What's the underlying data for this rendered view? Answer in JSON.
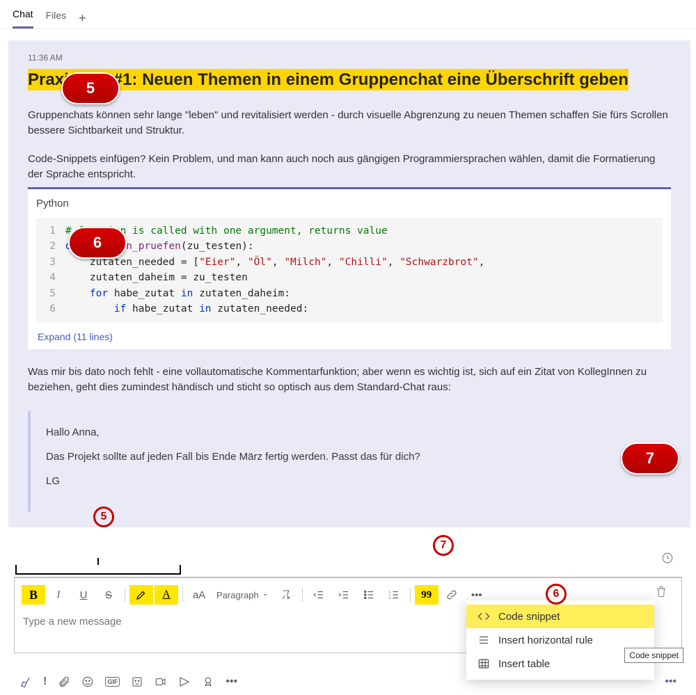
{
  "tabs": {
    "chat": "Chat",
    "files": "Files"
  },
  "message": {
    "time": "11:36 AM",
    "heading": "Praxistipp #1: Neuen Themen in einem Gruppenchat eine Überschrift geben",
    "p1": "Gruppenchats können sehr lange \"leben\" und revitalisiert werden - durch visuelle Abgrenzung zu neuen Themen schaffen Sie fürs Scrollen bessere Sichtbarkeit und Struktur.",
    "p2": "Code-Snippets einfügen? Kein Problem, und man kann auch noch aus gängigen Programmiersprachen wählen, damit die Formatierung der Sprache entspricht.",
    "p3": "Was mir bis dato noch fehlt - eine vollautomatische Kommentarfunktion; aber wenn es wichtig ist, sich auf ein Zitat von KollegInnen zu beziehen, geht dies zumindest händisch und sticht so optisch aus dem Standard-Chat raus:"
  },
  "code": {
    "language": "Python",
    "lines": [
      {
        "n": "1",
        "parts": [
          {
            "t": "spc",
            "v": ""
          },
          {
            "t": "com",
            "v": "# function is called with one argument, returns value"
          }
        ]
      },
      {
        "n": "2",
        "parts": [
          {
            "t": "kw",
            "v": "def "
          },
          {
            "t": "fn",
            "v": "zutaten_pruefen"
          },
          {
            "t": "",
            "v": "(zu_testen):"
          }
        ]
      },
      {
        "n": "3",
        "parts": [
          {
            "t": "",
            "v": "    zutaten_needed = ["
          },
          {
            "t": "str",
            "v": "\"Eier\""
          },
          {
            "t": "",
            "v": ", "
          },
          {
            "t": "str",
            "v": "\"Öl\""
          },
          {
            "t": "",
            "v": ", "
          },
          {
            "t": "str",
            "v": "\"Milch\""
          },
          {
            "t": "",
            "v": ", "
          },
          {
            "t": "str",
            "v": "\"Chilli\""
          },
          {
            "t": "",
            "v": ", "
          },
          {
            "t": "str",
            "v": "\"Schwarzbrot\""
          },
          {
            "t": "",
            "v": ","
          }
        ]
      },
      {
        "n": "4",
        "parts": [
          {
            "t": "",
            "v": "    zutaten_daheim = zu_testen"
          }
        ]
      },
      {
        "n": "5",
        "parts": [
          {
            "t": "",
            "v": "    "
          },
          {
            "t": "kw",
            "v": "for"
          },
          {
            "t": "",
            "v": " habe_zutat "
          },
          {
            "t": "kw",
            "v": "in"
          },
          {
            "t": "",
            "v": " zutaten_daheim:"
          }
        ]
      },
      {
        "n": "6",
        "parts": [
          {
            "t": "",
            "v": "        "
          },
          {
            "t": "kw",
            "v": "if"
          },
          {
            "t": "",
            "v": " habe_zutat "
          },
          {
            "t": "kw",
            "v": "in"
          },
          {
            "t": "",
            "v": " zutaten_needed:"
          }
        ]
      }
    ],
    "expand": "Expand (11 lines)"
  },
  "quote": {
    "greet": "Hallo Anna,",
    "body": "Das Projekt sollte auf jeden Fall bis Ende März fertig werden. Passt das für dich?",
    "sig": "LG"
  },
  "toolbar": {
    "bold": "B",
    "italic": "I",
    "underline": "U",
    "strike": "S",
    "textsize": "aA",
    "paragraph": "Paragraph",
    "quote_sym": "99"
  },
  "compose": {
    "placeholder": "Type a new message"
  },
  "dropdown": {
    "code_snippet": "Code snippet",
    "hr": "Insert horizontal rule",
    "table": "Insert table",
    "tooltip": "Code snippet"
  },
  "callouts": {
    "c5": "5",
    "c6": "6",
    "c7": "7"
  }
}
